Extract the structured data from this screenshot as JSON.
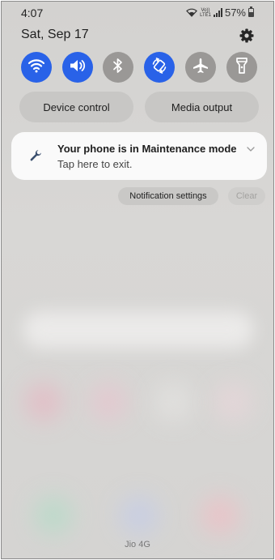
{
  "status_bar": {
    "time": "4:07",
    "volte_top": "Vo))",
    "volte_bottom": "LTE1",
    "battery_text": "57%",
    "battery_level": 0.57
  },
  "header": {
    "date": "Sat, Sep 17"
  },
  "quick_toggles": [
    {
      "name": "wifi",
      "icon": "wifi-icon",
      "state": "on"
    },
    {
      "name": "sound",
      "icon": "speaker-icon",
      "state": "on"
    },
    {
      "name": "bluetooth",
      "icon": "bluetooth-icon",
      "state": "off"
    },
    {
      "name": "auto-rotate",
      "icon": "rotate-icon",
      "state": "on"
    },
    {
      "name": "airplane-mode",
      "icon": "airplane-icon",
      "state": "off"
    },
    {
      "name": "flashlight",
      "icon": "flashlight-icon",
      "state": "off"
    }
  ],
  "panel_buttons": {
    "device_control": "Device control",
    "media_output": "Media output"
  },
  "notification": {
    "icon": "wrench-icon",
    "title": "Your phone is in Maintenance mode",
    "subtitle": "Tap here to exit."
  },
  "notification_actions": {
    "settings": "Notification settings",
    "clear": "Clear"
  },
  "carrier": "Jio 4G",
  "colors": {
    "accent": "#2962e8",
    "toggle_off": "#9a9896",
    "card_bg": "#fafafa"
  }
}
